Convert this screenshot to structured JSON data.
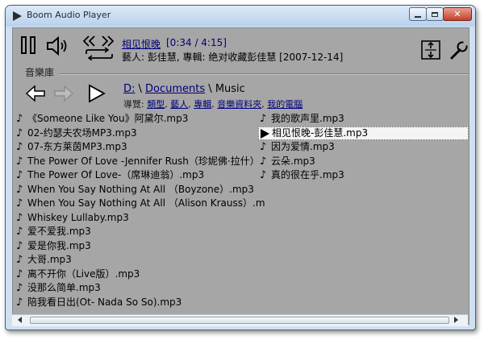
{
  "window": {
    "title": "Boom Audio Player"
  },
  "now_playing": {
    "title": "相见恨晚",
    "time": "[0:34 / 4:15]",
    "meta": "藝人: 彭佳慧, 專輯: 绝对收藏彭佳慧 [2007-12-14]"
  },
  "library": {
    "section_label": "音樂庫",
    "path": {
      "drive": "D:",
      "sep1": " \\ ",
      "folder": "Documents",
      "sep2": " \\ ",
      "current": "Music"
    },
    "nav": {
      "label": "導覽:",
      "links": [
        "類型",
        "藝人",
        "專輯",
        "音樂資料夾",
        "我的電腦"
      ],
      "sep": ", "
    }
  },
  "files_left": [
    "《Someone Like You》阿黛尔.mp3",
    "02-约瑟夫农场MP3.mp3",
    "07-东方莱茵MP3.mp3",
    "The Power Of Love -Jennifer Rush（珍妮佛·拉什）",
    "The Power Of Love-（席琳迪翁）.mp3",
    "When You Say Nothing At All （Boyzone）.mp3",
    "When You Say Nothing At All （Alison Krauss）.m",
    "Whiskey Lullaby.mp3",
    "爱不爱我.mp3",
    "爱是你我.mp3",
    "大哥.mp3",
    "离不开你（Live版）.mp3",
    "没那么简单.mp3",
    "陪我看日出(Ot- Nada So So).mp3"
  ],
  "files_right": [
    "我的歌声里.mp3",
    "相见恨晚-彭佳慧.mp3",
    "因为爱情.mp3",
    "云朵.mp3",
    "真的很在乎.mp3"
  ],
  "selected_index_right": 1,
  "icons": {
    "note": "♪"
  }
}
